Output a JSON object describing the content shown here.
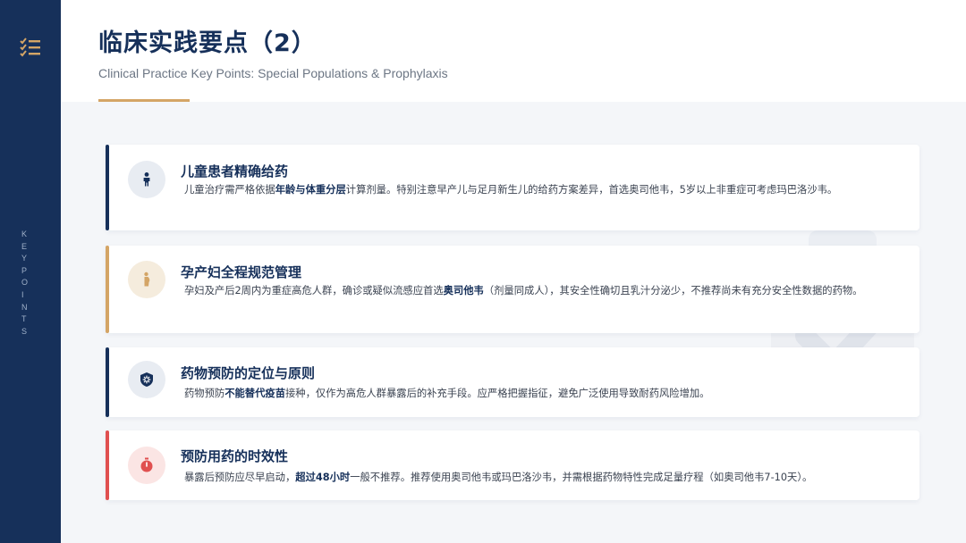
{
  "header": {
    "title": "临床实践要点（2）",
    "subtitle": "Clinical Practice Key Points: Special Populations & Prophylaxis"
  },
  "sidebar": {
    "vertical_text": "KEYPOINTS",
    "logo_icon": "checklist-icon"
  },
  "colors": {
    "navy": "#16305a",
    "gold": "#d4a566",
    "red": "#e05050",
    "text": "#3a4250"
  },
  "cards": [
    {
      "title": "儿童患者精确给药",
      "icon": "child-icon",
      "accent": "#16305a",
      "desc_parts": [
        "儿童治疗需严格依据",
        "年龄与体重分层",
        "计算剂量。特别注意早产儿与足月新生儿的给药方案差异，首选奥司他韦，5岁以上非重症可考虑玛巴洛沙韦。"
      ]
    },
    {
      "title": "孕产妇全程规范管理",
      "icon": "pregnant-woman-icon",
      "accent": "#d4a566",
      "desc_parts": [
        "孕妇及产后2周内为重症高危人群，确诊或疑似流感应首选",
        "奥司他韦",
        "（剂量同成人），其安全性确切且乳汁分泌少，不推荐尚未有充分安全性数据的药物。"
      ]
    },
    {
      "title": "药物预防的定位与原则",
      "icon": "shield-virus-icon",
      "accent": "#16305a",
      "desc_parts": [
        "药物预防",
        "不能替代疫苗",
        "接种，仅作为高危人群暴露后的补充手段。应严格把握指征，避免广泛使用导致耐药风险增加。"
      ]
    },
    {
      "title": "预防用药的时效性",
      "icon": "stopwatch-icon",
      "accent": "#e05050",
      "desc_parts": [
        "暴露后预防应尽早启动，",
        "超过48小时",
        "一般不推荐。推荐使用奥司他韦或玛巴洛沙韦，并需根据药物特性完成足量疗程（如奥司他韦7-10天）。"
      ]
    }
  ]
}
